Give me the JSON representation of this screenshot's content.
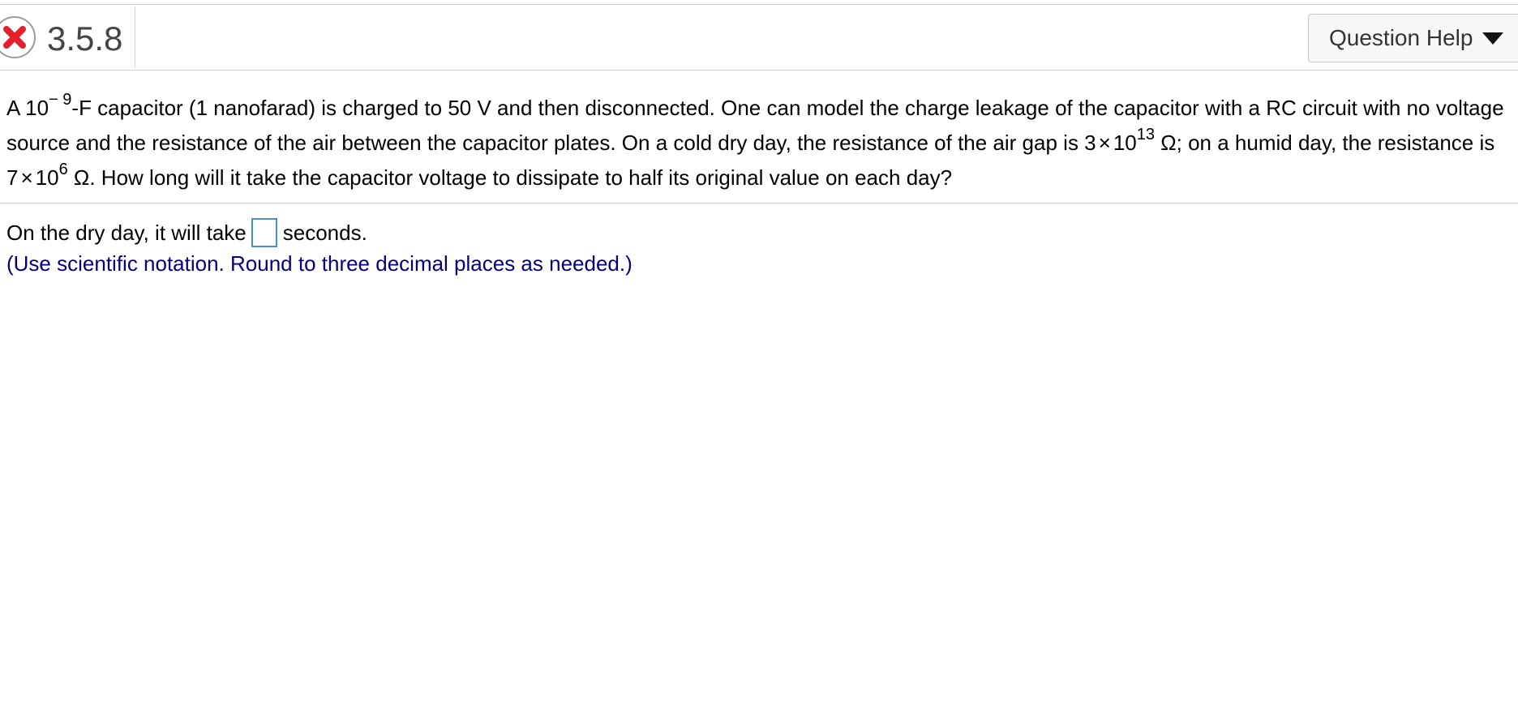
{
  "header": {
    "status": "incorrect",
    "status_icon": "x-circle-icon",
    "status_color": "#e4202f",
    "question_number": "3.5.8",
    "help_button_label": "Question Help",
    "help_caret_icon": "triangle-down-icon"
  },
  "problem": {
    "line1_a": "A 10",
    "line1_exp": "− 9",
    "line1_b": "-F capacitor (1 nanofarad) is charged to 50 V and then disconnected. One can model the charge leakage of the capacitor with a RC circuit with no voltage",
    "line2_a": "source and the resistance of the air between the capacitor plates. On a cold dry day, the resistance of the air gap is 3",
    "line2_times": "×",
    "line2_base": "10",
    "line2_exp": "13",
    "line2_b": " Ω; on a humid day, the resistance is",
    "line3_a": "7",
    "line3_times": "×",
    "line3_base": "10",
    "line3_exp": "6",
    "line3_b": " Ω. How long will it take the capacitor voltage to dissipate to half its original value on each day?"
  },
  "answer": {
    "prefix": "On the dry day, it will take",
    "value": "",
    "suffix": "seconds.",
    "hint": "(Use scientific notation. Round to three decimal places as needed.)",
    "hint_color": "#000080"
  }
}
